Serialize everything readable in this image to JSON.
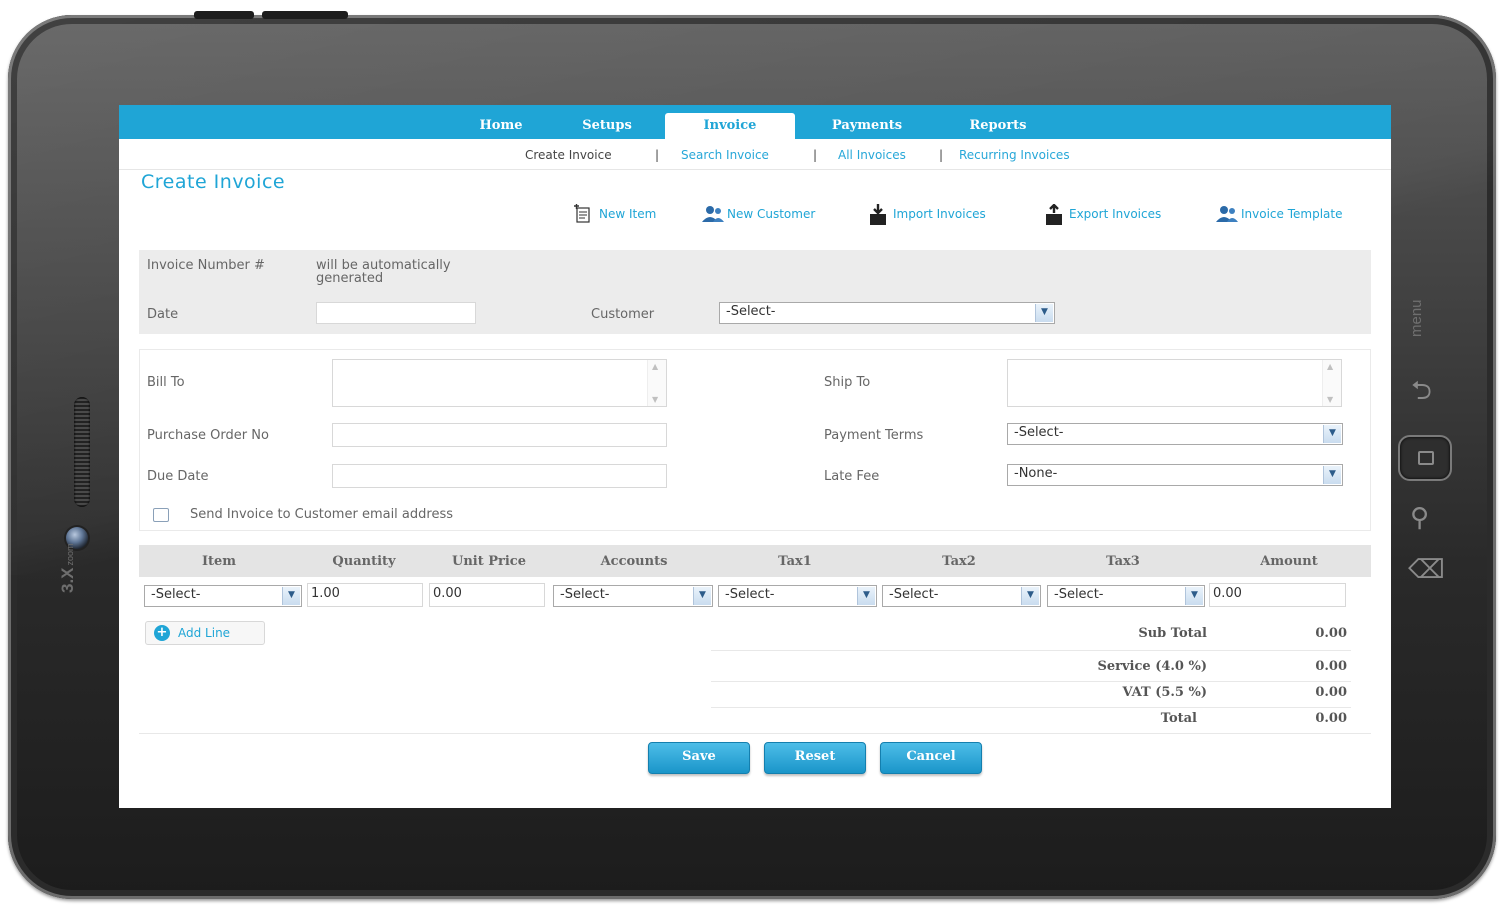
{
  "device": {
    "brand": "3.X",
    "brand_sub": "zoom",
    "side_label": "menu"
  },
  "nav": {
    "items": [
      {
        "label": "Home"
      },
      {
        "label": "Setups"
      },
      {
        "label": "Invoice"
      },
      {
        "label": "Payments"
      },
      {
        "label": "Reports"
      }
    ],
    "active": "Invoice"
  },
  "subnav": {
    "items": [
      {
        "label": "Create Invoice"
      },
      {
        "label": "Search Invoice"
      },
      {
        "label": "All Invoices"
      },
      {
        "label": "Recurring Invoices"
      }
    ],
    "separator": "|"
  },
  "page": {
    "title": "Create Invoice"
  },
  "toolbar": {
    "new_item": "New Item",
    "new_customer": "New Customer",
    "import_invoices": "Import Invoices",
    "export_invoices": "Export Invoices",
    "invoice_template": "Invoice Template"
  },
  "form": {
    "invoice_number_label": "Invoice Number #",
    "invoice_number_value": "will be automatically generated",
    "date_label": "Date",
    "customer_label": "Customer",
    "customer_value": "-Select-",
    "bill_to_label": "Bill To",
    "ship_to_label": "Ship To",
    "po_label": "Purchase Order No",
    "payment_terms_label": "Payment Terms",
    "payment_terms_value": "-Select-",
    "due_date_label": "Due Date",
    "late_fee_label": "Late Fee",
    "late_fee_value": "-None-",
    "send_email_label": "Send Invoice to Customer email address"
  },
  "items_table": {
    "headers": [
      "Item",
      "Quantity",
      "Unit Price",
      "Accounts",
      "Tax1",
      "Tax2",
      "Tax3",
      "Amount"
    ],
    "row": {
      "item": "-Select-",
      "quantity": "1.00",
      "unit_price": "0.00",
      "accounts": "-Select-",
      "tax1": "-Select-",
      "tax2": "-Select-",
      "tax3": "-Select-",
      "amount": "0.00"
    },
    "add_line": "Add Line"
  },
  "totals": {
    "sub_total_label": "Sub Total",
    "sub_total_value": "0.00",
    "service_label": "Service (4.0 %)",
    "service_value": "0.00",
    "vat_label": "VAT (5.5 %)",
    "vat_value": "0.00",
    "total_label": "Total",
    "total_value": "0.00"
  },
  "actions": {
    "save": "Save",
    "reset": "Reset",
    "cancel": "Cancel"
  },
  "colors": {
    "accent": "#1fa5d6",
    "frame": "#2a2a2a"
  }
}
